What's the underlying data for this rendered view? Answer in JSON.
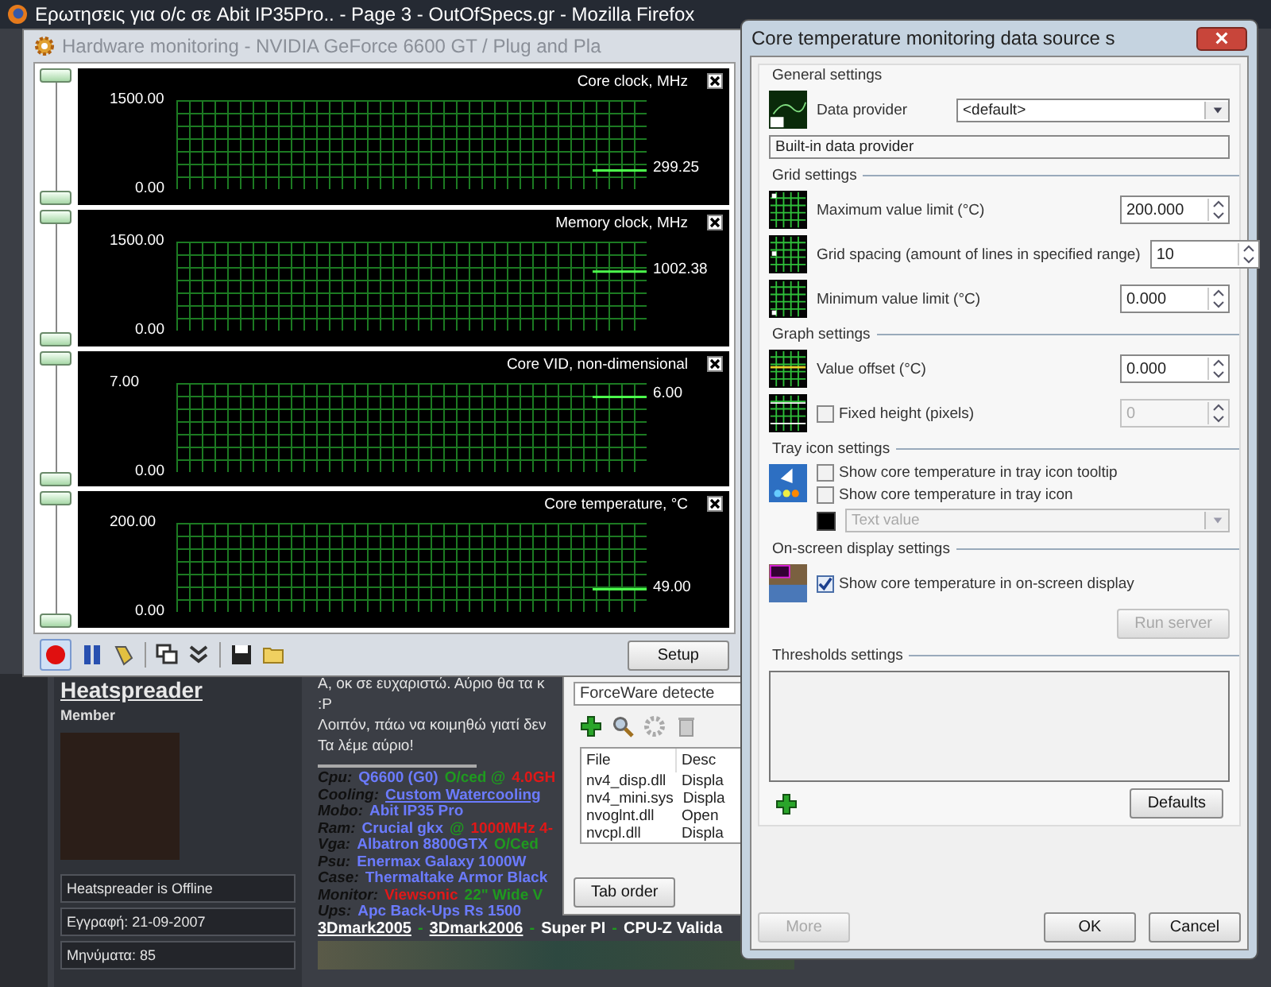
{
  "browser": {
    "title": "Ερωτησεις για o/c σε Abit IP35Pro.. - Page 3 - OutOfSpecs.gr - Mozilla Firefox"
  },
  "monitor_window": {
    "title": "Hardware monitoring - NVIDIA GeForce 6600 GT / Plug and Pla",
    "graphs": [
      {
        "title": "Core clock, MHz",
        "max_label": "1500.00",
        "min_label": "0.00",
        "reading": "299.25"
      },
      {
        "title": "Memory clock, MHz",
        "max_label": "1500.00",
        "min_label": "0.00",
        "reading": "1002.38"
      },
      {
        "title": "Core VID, non-dimensional",
        "max_label": "7.00",
        "min_label": "0.00",
        "reading": "6.00"
      },
      {
        "title": "Core temperature, °C",
        "max_label": "200.00",
        "min_label": "0.00",
        "reading": "49.00"
      }
    ],
    "recording": true,
    "setup_button": "Setup"
  },
  "forum_post": {
    "user": {
      "name": "Heatspreader",
      "rank": "Member",
      "status": "Heatspreader is Offline",
      "joined": "Εγγραφή: 21-09-2007",
      "posts": "Μηνύματα: 85"
    },
    "message_lines": [
      "Α, οκ σε ευχαριστώ. Αύριο θα τα κ",
      ":P",
      "Λοιπόν, πάω να κοιμηθώ γιατί δεν",
      "Τα λέμε αύριο!"
    ],
    "signature": [
      {
        "label": "Cpu:",
        "parts": [
          {
            "text": "Q6600 (G0)",
            "color": "#6b7bff",
            "link": false
          },
          {
            "text": "O/ced @",
            "color": "#1f9a1f",
            "link": false
          },
          {
            "text": "4.0GH",
            "color": "#e01818",
            "link": false
          }
        ]
      },
      {
        "label": "Cooling:",
        "parts": [
          {
            "text": "Custom Watercooling",
            "color": "#6b7bff",
            "link": true
          }
        ]
      },
      {
        "label": "Mobo:",
        "parts": [
          {
            "text": "Abit IP35 Pro",
            "color": "#6b7bff",
            "link": false
          }
        ]
      },
      {
        "label": "Ram:",
        "parts": [
          {
            "text": "Crucial gkx",
            "color": "#6b7bff",
            "link": false
          },
          {
            "text": "@",
            "color": "#1f9a1f",
            "link": false
          },
          {
            "text": "1000MHz 4-",
            "color": "#e01818",
            "link": false
          }
        ]
      },
      {
        "label": "Vga:",
        "parts": [
          {
            "text": "Albatron 8800GTX",
            "color": "#6b7bff",
            "link": false
          },
          {
            "text": "O/Ced",
            "color": "#1f9a1f",
            "link": false
          }
        ]
      },
      {
        "label": "Psu:",
        "parts": [
          {
            "text": "Enermax Galaxy 1000W",
            "color": "#6b7bff",
            "link": false
          }
        ]
      },
      {
        "label": "Case:",
        "parts": [
          {
            "text": "Thermaltake Armor Black",
            "color": "#6b7bff",
            "link": false
          }
        ]
      },
      {
        "label": "Monitor:",
        "parts": [
          {
            "text": "Viewsonic",
            "color": "#e01818",
            "link": false
          },
          {
            "text": "22\" Wide V",
            "color": "#1f9a1f",
            "link": false
          }
        ]
      },
      {
        "label": "Ups:",
        "parts": [
          {
            "text": "Apc Back-Ups Rs 1500",
            "color": "#6b7bff",
            "link": false
          }
        ]
      }
    ],
    "benchmark_links": [
      {
        "text": "3Dmark2005",
        "color": "#ffffff",
        "link": true
      },
      {
        "text": "-",
        "color": "#1f9a1f",
        "link": false
      },
      {
        "text": "3Dmark2006",
        "color": "#ffffff",
        "link": true
      },
      {
        "text": "-",
        "color": "#1f9a1f",
        "link": false
      },
      {
        "text": "Super PI",
        "color": "#ffffff",
        "link": false
      },
      {
        "text": "-",
        "color": "#1f9a1f",
        "link": false
      },
      {
        "text": "CPU-Z Valida",
        "color": "#ffffff",
        "link": false
      }
    ]
  },
  "driver_window": {
    "detected": "ForceWare detecte",
    "columns": [
      "File",
      "Desc"
    ],
    "rows": [
      [
        "nv4_disp.dll",
        "Displa"
      ],
      [
        "nv4_mini.sys",
        "Displa"
      ],
      [
        "nvoglnt.dll",
        "Open"
      ],
      [
        "nvcpl.dll",
        "Displa"
      ]
    ],
    "tab_order_button": "Tab order"
  },
  "settings_dialog": {
    "title": "Core temperature monitoring data source s",
    "general": {
      "title": "General settings",
      "provider_label": "Data provider",
      "provider_value": "<default>",
      "provider_description": "Built-in data provider"
    },
    "grid": {
      "title": "Grid settings",
      "rows": [
        {
          "label": "Maximum value limit (°C)",
          "value": "200.000"
        },
        {
          "label": "Grid spacing (amount of lines in specified range)",
          "value": "10"
        },
        {
          "label": "Minimum value limit (°C)",
          "value": "0.000"
        }
      ]
    },
    "graph": {
      "title": "Graph settings",
      "offset": {
        "label": "Value offset (°C)",
        "value": "0.000"
      },
      "fixed_height": {
        "label": "Fixed height (pixels)",
        "checked": false,
        "value": "0"
      }
    },
    "tray": {
      "title": "Tray icon settings",
      "options": [
        {
          "label": "Show core temperature in tray icon tooltip",
          "checked": false
        },
        {
          "label": "Show core temperature in tray icon",
          "checked": false
        }
      ],
      "color": "#000000",
      "display_mode": {
        "value": "Text value",
        "disabled": true
      }
    },
    "osd": {
      "title": "On-screen display settings",
      "option": {
        "label": "Show core temperature in on-screen display",
        "checked": true
      },
      "run_server": {
        "label": "Run server",
        "disabled": true
      }
    },
    "thresholds": {
      "title": "Thresholds settings",
      "defaults_button": "Defaults"
    },
    "buttons": [
      {
        "label": "More",
        "disabled": true
      },
      {
        "label": "OK",
        "disabled": false
      },
      {
        "label": "Cancel",
        "disabled": false
      }
    ]
  }
}
